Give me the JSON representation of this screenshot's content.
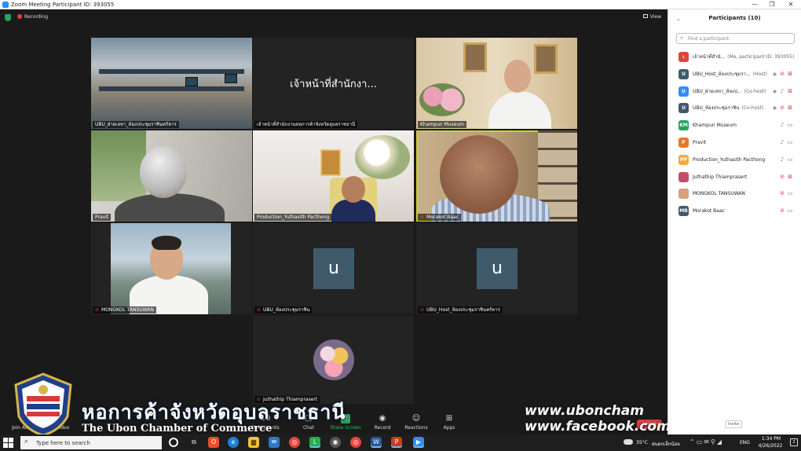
{
  "window": {
    "title": "Zoom Meeting Participant ID: 393055",
    "minimize": "—",
    "restore": "❐",
    "close": "✕"
  },
  "meeting": {
    "recording_label": "Recording",
    "view_label": "View"
  },
  "tiles": [
    {
      "name": "UBU_ฝ่ายเลขา_ห้องประชุมราชินทร์หาร",
      "muted": false
    },
    {
      "name": "เจ้าหน้าที่สำนักงานหอการค้าจังหวัดอุบลราชธานี",
      "big_label": "เจ้าหน้าที่สำนักงา...",
      "muted": false
    },
    {
      "name": "Khampun Museum",
      "muted": false
    },
    {
      "name": "Pravit",
      "muted": false
    },
    {
      "name": "Production_Yuthasith Pacthong",
      "muted": false
    },
    {
      "name": "Morakot Baac",
      "muted": true
    },
    {
      "name": "MONGKOL TANSUWAN",
      "muted": true
    },
    {
      "name": "UBU_ห้องประชุมราชิน",
      "avatar": "u",
      "muted": true
    },
    {
      "name": "UBU_Host_ห้องประชุมราชินทร์หาร",
      "avatar": "u",
      "muted": true
    },
    {
      "name": "Juthathip Thiamprasert",
      "muted": true
    }
  ],
  "toolbar": {
    "join_audio": "Join Audio",
    "stop_video": "Video",
    "participants": "Participants",
    "participants_count": "10",
    "chat": "Chat",
    "share_screen": "Share Screen",
    "record": "Record",
    "reactions": "Reactions",
    "apps": "Apps",
    "leave": "Leave"
  },
  "overlay": {
    "org_thai": "หอการค้าจังหวัดอุบลราชธานี",
    "org_english": "The Ubon Chamber of Commerce",
    "website": "www.uboncham",
    "facebook": "www.facebook.com/",
    "logo_icon": "chamber-crest-icon"
  },
  "panel": {
    "title": "Participants (10)",
    "search_placeholder": "Find a participant",
    "invite_label": "Invite",
    "participants": [
      {
        "initials": "เ",
        "color": "#e0453b",
        "name": "เจ้าหน้าที่สำนั...",
        "role": "(Me, participant ID: 393055)",
        "mic": "",
        "cam": ""
      },
      {
        "initials": "U",
        "color": "#3f5b6b",
        "name": "UBU_Host_ห้องประชุมรา...",
        "role": "(Host)",
        "mic": "muted",
        "cam": "off"
      },
      {
        "initials": "U",
        "color": "#2d8cff",
        "name": "UBU_ฝ่ายเลขา_ห้องป...",
        "role": "(Co-host)",
        "mic": "on",
        "cam": "off"
      },
      {
        "initials": "U",
        "color": "#3f5b6b",
        "name": "UBU_ห้องประชุมราชิน",
        "role": "(Co-host)",
        "mic": "muted",
        "cam": "off"
      },
      {
        "initials": "KM",
        "color": "#23a55a",
        "name": "Khampun Museum",
        "role": "",
        "mic": "on",
        "cam": "on"
      },
      {
        "initials": "P",
        "color": "#e8782a",
        "name": "Pravit",
        "role": "",
        "mic": "on",
        "cam": "on"
      },
      {
        "initials": "PP",
        "color": "#f2a93b",
        "name": "Production_Yuthasith Pacthong",
        "role": "",
        "mic": "on",
        "cam": "on"
      },
      {
        "initials": "",
        "color": "#c0506a",
        "name": "Juthathip Thiamprasert",
        "role": "",
        "mic": "muted",
        "cam": "off"
      },
      {
        "initials": "",
        "color": "#d6a07e",
        "name": "MONGKOL TANSUWAN",
        "role": "",
        "mic": "muted",
        "cam": "on"
      },
      {
        "initials": "MB",
        "color": "#3f5b6b",
        "name": "Morakot Baac",
        "role": "",
        "mic": "muted",
        "cam": "on"
      }
    ]
  },
  "taskbar": {
    "search_placeholder": "Type here to search",
    "temperature": "35°C",
    "weather_city": "ฝนตกเล็กน้อย",
    "language": "ENG",
    "time": "1:34 PM",
    "date": "4/26/2022",
    "notifications": "2"
  },
  "colors": {
    "active_speaker": "#c7d12b",
    "mute_red": "#e63e3e",
    "share_green": "#23a55a",
    "zoom_blue": "#2d8cff"
  }
}
